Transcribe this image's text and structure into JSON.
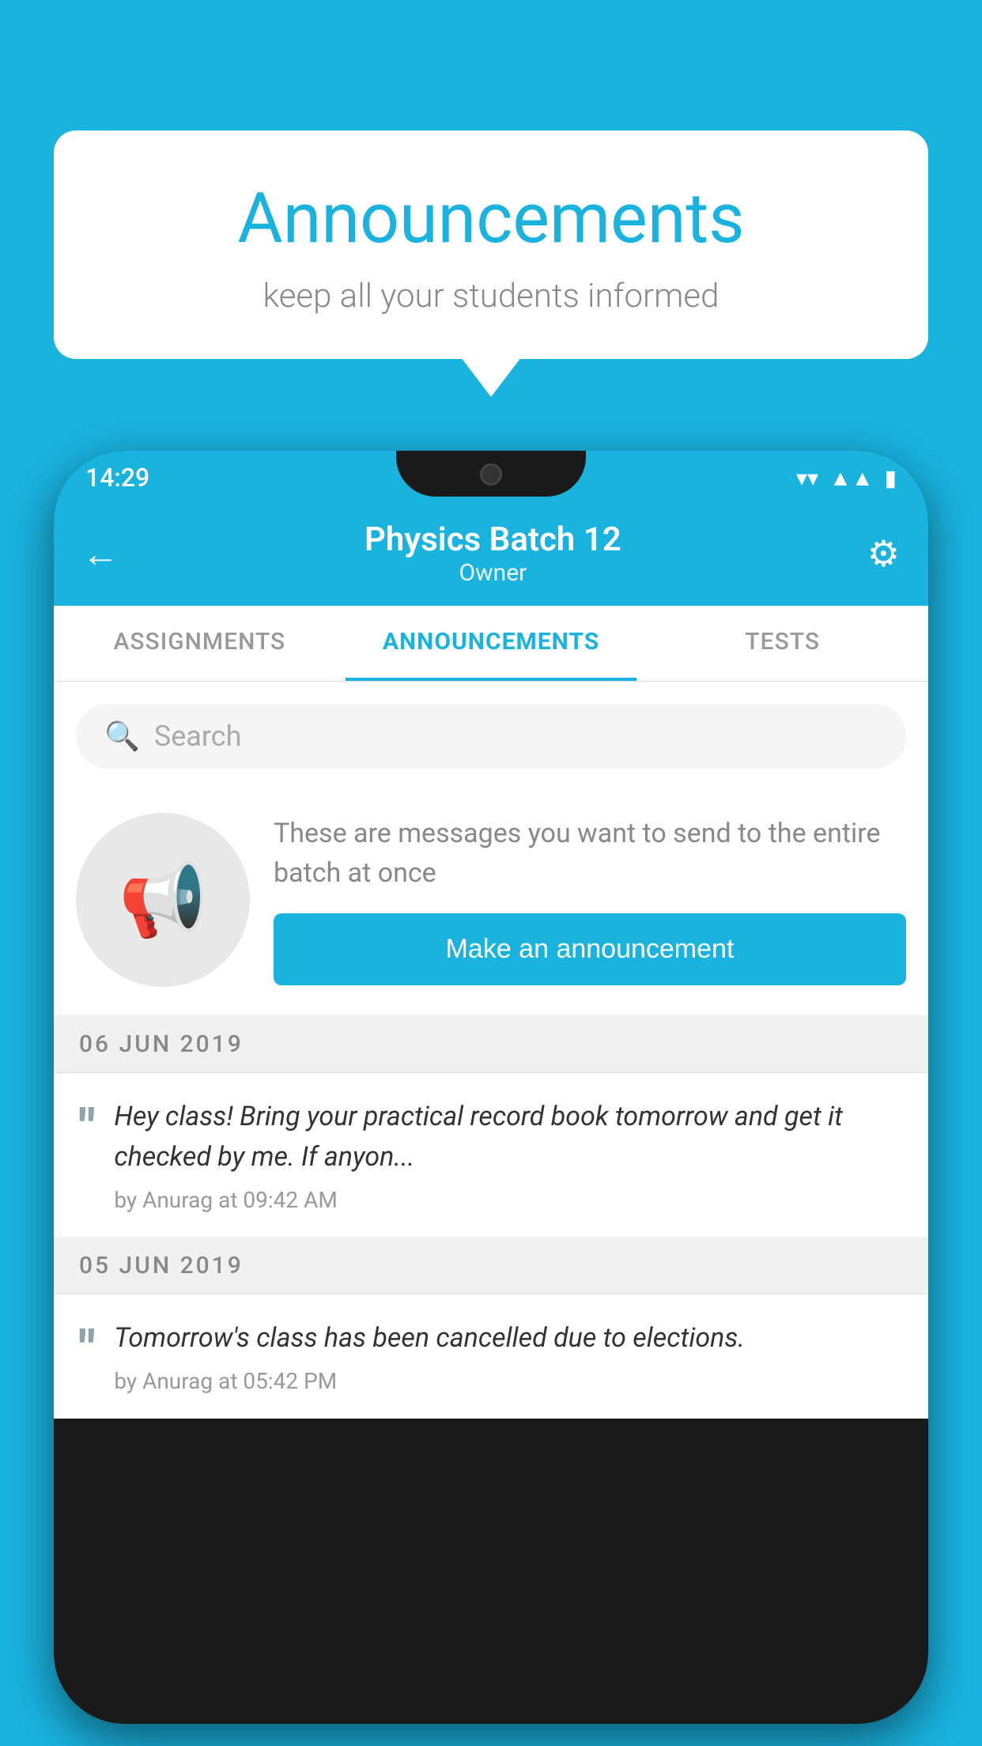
{
  "background_color": "#1ab3e0",
  "speech_bubble": {
    "title": "Announcements",
    "subtitle": "keep all your students informed"
  },
  "phone": {
    "status_bar": {
      "time": "14:29",
      "icons": [
        "wifi",
        "signal",
        "battery"
      ]
    },
    "app_bar": {
      "back_label": "←",
      "title": "Physics Batch 12",
      "subtitle": "Owner",
      "settings_label": "⚙"
    },
    "tabs": [
      {
        "label": "ASSIGNMENTS",
        "active": false
      },
      {
        "label": "ANNOUNCEMENTS",
        "active": true
      },
      {
        "label": "TESTS",
        "active": false
      }
    ],
    "search": {
      "placeholder": "Search"
    },
    "promo": {
      "description": "These are messages you want to send to the entire batch at once",
      "button_label": "Make an announcement"
    },
    "announcements": [
      {
        "date": "06  JUN  2019",
        "text": "Hey class! Bring your practical record book tomorrow and get it checked by me. If anyon...",
        "meta": "by Anurag at 09:42 AM"
      },
      {
        "date": "05  JUN  2019",
        "text": "Tomorrow's class has been cancelled due to elections.",
        "meta": "by Anurag at 05:42 PM"
      }
    ]
  }
}
